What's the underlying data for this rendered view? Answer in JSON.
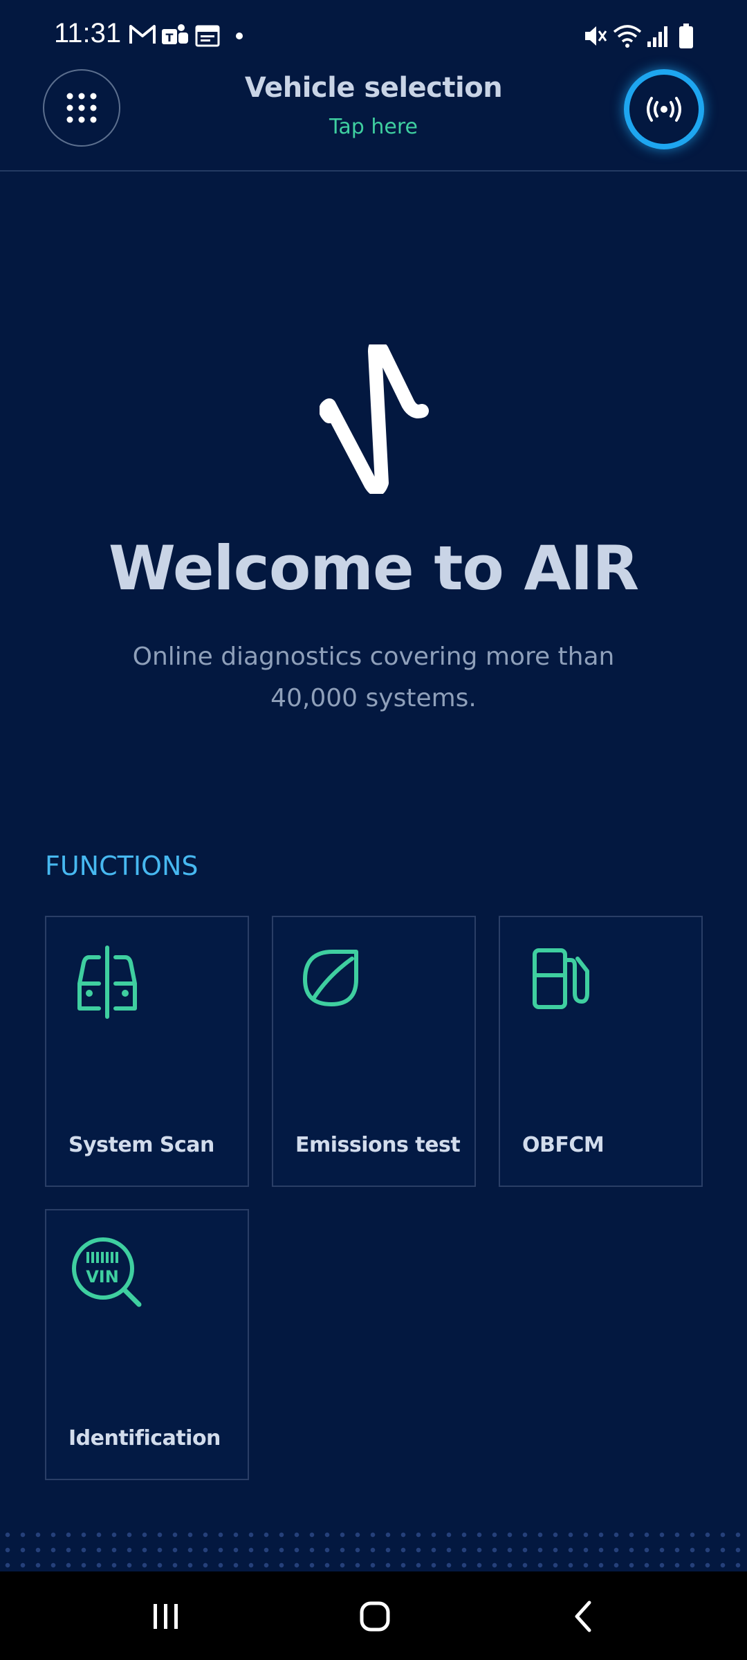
{
  "status_bar": {
    "time": "11:31",
    "left_icons": [
      "gmail-icon",
      "teams-icon",
      "calendar-icon",
      "dot-icon"
    ],
    "right_icons": [
      "mute-icon",
      "wifi-icon",
      "signal-icon",
      "battery-icon"
    ]
  },
  "header": {
    "title": "Vehicle selection",
    "subtitle": "Tap here",
    "menu_icon": "grid-dots-icon",
    "connect_icon": "broadcast-icon"
  },
  "welcome": {
    "title": "Welcome to AIR",
    "subtitle": "Online diagnostics covering more than 40,000 systems."
  },
  "functions": {
    "heading": "FUNCTIONS",
    "items": [
      {
        "label": "System Scan",
        "icon": "car-scan-icon"
      },
      {
        "label": "Emissions test",
        "icon": "leaf-icon"
      },
      {
        "label": "OBFCM",
        "icon": "fuel-pump-icon"
      },
      {
        "label": "Identification",
        "icon": "vin-search-icon"
      }
    ]
  },
  "nav_bar": {
    "buttons": [
      "recent-apps-icon",
      "home-icon",
      "back-icon"
    ]
  },
  "colors": {
    "background": "#031840",
    "accent_green": "#3fcfa0",
    "accent_blue": "#1ea6f0",
    "heading_blue": "#47b8f0"
  }
}
